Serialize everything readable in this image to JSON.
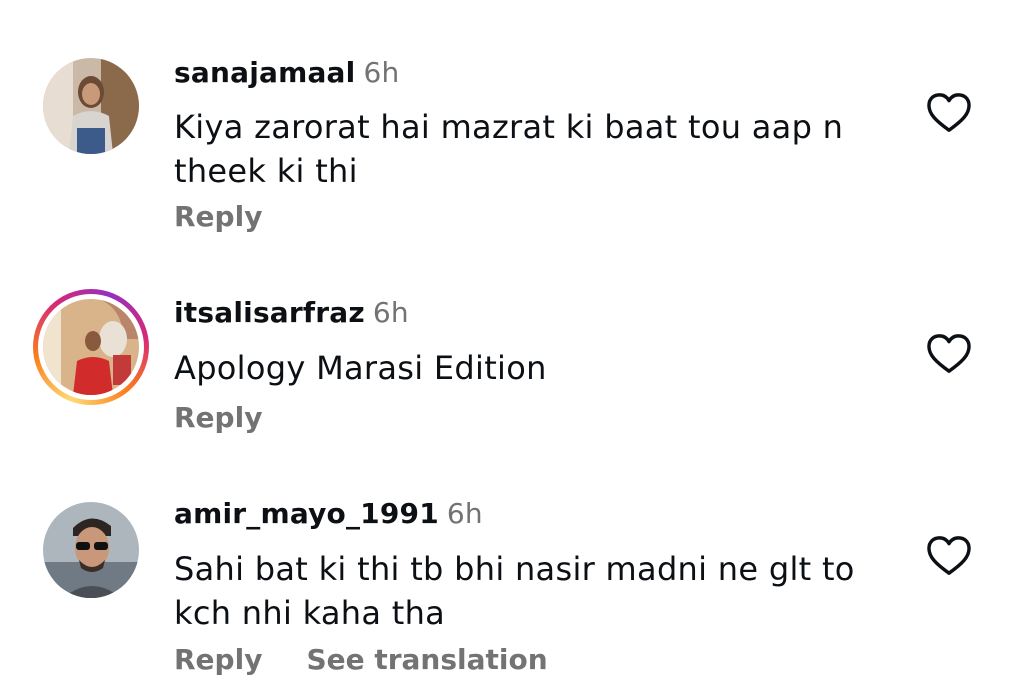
{
  "comments": [
    {
      "username": "sanajamaal",
      "time": "6h",
      "text": "Kiya zarorat hai mazrat ki baat tou aap n theek ki thi",
      "reply_label": "Reply",
      "like_icon": "heart-outline-icon",
      "story_ring": false
    },
    {
      "username": "itsalisarfraz",
      "time": "6h",
      "text": "Apology Marasi Edition",
      "reply_label": "Reply",
      "like_icon": "heart-outline-icon",
      "story_ring": true
    },
    {
      "username": "amir_mayo_1991",
      "time": "6h",
      "text": "Sahi bat ki thi tb bhi nasir madni ne glt to kch nhi kaha tha",
      "reply_label": "Reply",
      "translate_label": "See translation",
      "like_icon": "heart-outline-icon",
      "story_ring": false
    }
  ],
  "colors": {
    "text": "#0c1014",
    "secondary": "#737373",
    "background": "#ffffff"
  }
}
